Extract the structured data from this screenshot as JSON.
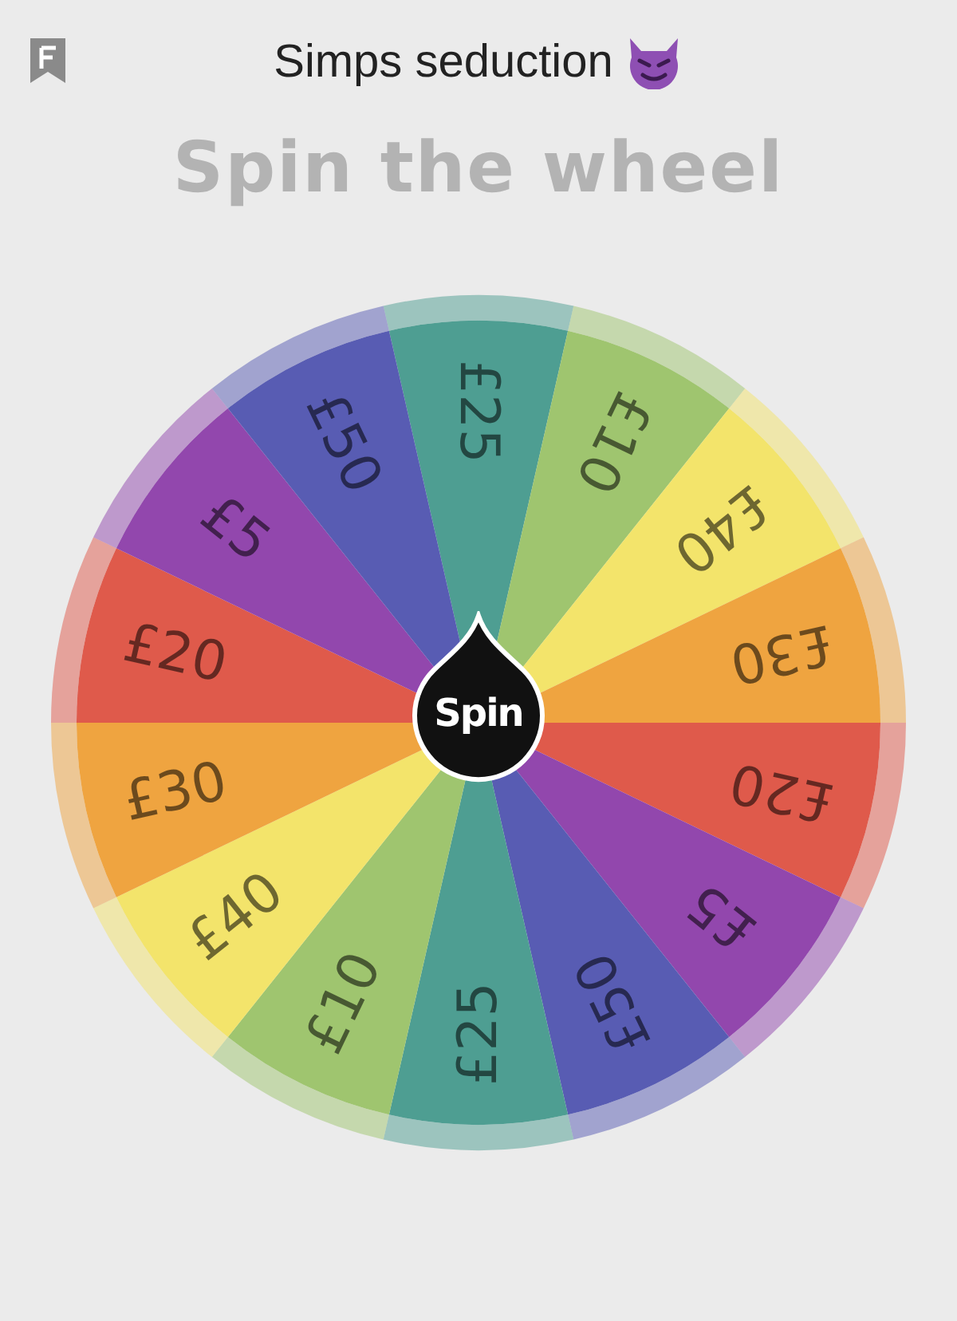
{
  "header": {
    "title": "Simps seduction"
  },
  "heading": "Spin the wheel",
  "wheel": {
    "segments": [
      {
        "label": "£25",
        "color": "#4e9e92"
      },
      {
        "label": "£10",
        "color": "#9fc56f"
      },
      {
        "label": "£40",
        "color": "#f3e46b"
      },
      {
        "label": "£30",
        "color": "#efa440"
      },
      {
        "label": "£20",
        "color": "#df5a4b"
      },
      {
        "label": "£5",
        "color": "#9247ad"
      },
      {
        "label": "£50",
        "color": "#585cb3"
      },
      {
        "label": "£25",
        "color": "#4e9e92"
      },
      {
        "label": "£10",
        "color": "#9fc56f"
      },
      {
        "label": "£40",
        "color": "#f3e46b"
      },
      {
        "label": "£30",
        "color": "#efa440"
      },
      {
        "label": "£20",
        "color": "#df5a4b"
      },
      {
        "label": "£5",
        "color": "#9247ad"
      },
      {
        "label": "£50",
        "color": "#585cb3"
      }
    ],
    "spin_button": "Spin"
  }
}
